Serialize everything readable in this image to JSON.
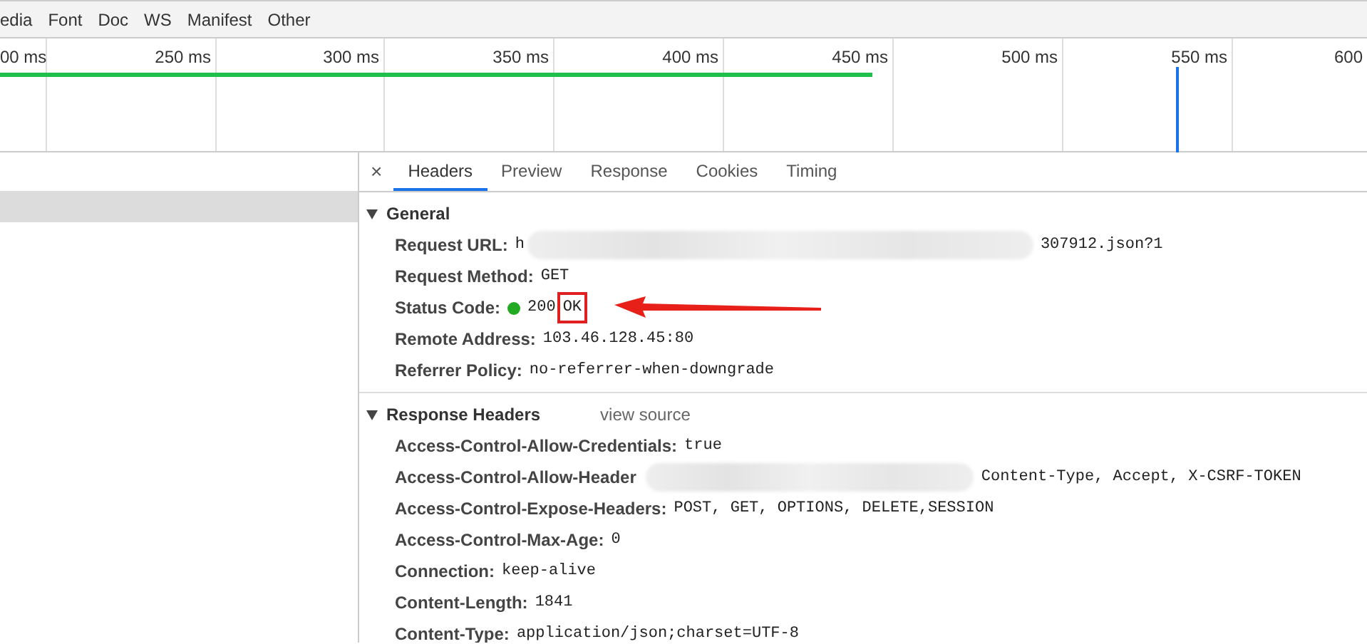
{
  "filters": [
    "edia",
    "Font",
    "Doc",
    "WS",
    "Manifest",
    "Other"
  ],
  "timeline": {
    "ticks": [
      "00 ms",
      "250 ms",
      "300 ms",
      "350 ms",
      "400 ms",
      "450 ms",
      "500 ms",
      "550 ms",
      "600"
    ]
  },
  "detail_tabs": {
    "close": "×",
    "tabs": [
      {
        "label": "Headers",
        "selected": true
      },
      {
        "label": "Preview",
        "selected": false
      },
      {
        "label": "Response",
        "selected": false
      },
      {
        "label": "Cookies",
        "selected": false
      },
      {
        "label": "Timing",
        "selected": false
      }
    ]
  },
  "sections": [
    {
      "title": "General",
      "expanded": true,
      "rows": [
        {
          "name": "Request URL:",
          "value": "h",
          "redacted": true,
          "value_after": "307912.json?1"
        },
        {
          "name": "Request Method:",
          "value": "GET"
        },
        {
          "name": "Status Code:",
          "kind": "status",
          "color": "#22aa22",
          "value": "200",
          "status_text": "OK",
          "highlighted": true
        },
        {
          "name": "Remote Address:",
          "value": "103.46.128.45:80"
        },
        {
          "name": "Referrer Policy:",
          "value": "no-referrer-when-downgrade"
        }
      ]
    },
    {
      "title": "Response Headers",
      "expanded": true,
      "link": "view source",
      "rows": [
        {
          "name": "Access-Control-Allow-Credentials:",
          "value": "true"
        },
        {
          "name": "Access-Control-Allow-Header",
          "redacted": true,
          "value_after": "Content-Type, Accept, X-CSRF-TOKEN"
        },
        {
          "name": "Access-Control-Expose-Headers:",
          "value": "POST, GET, OPTIONS, DELETE,SESSION"
        },
        {
          "name": "Access-Control-Max-Age:",
          "value": "0"
        },
        {
          "name": "Connection:",
          "value": "keep-alive"
        },
        {
          "name": "Content-Length:",
          "value": "1841"
        },
        {
          "name": "Content-Type:",
          "value": "application/json;charset=UTF-8"
        }
      ]
    }
  ],
  "annotation": {
    "arrow": true
  }
}
